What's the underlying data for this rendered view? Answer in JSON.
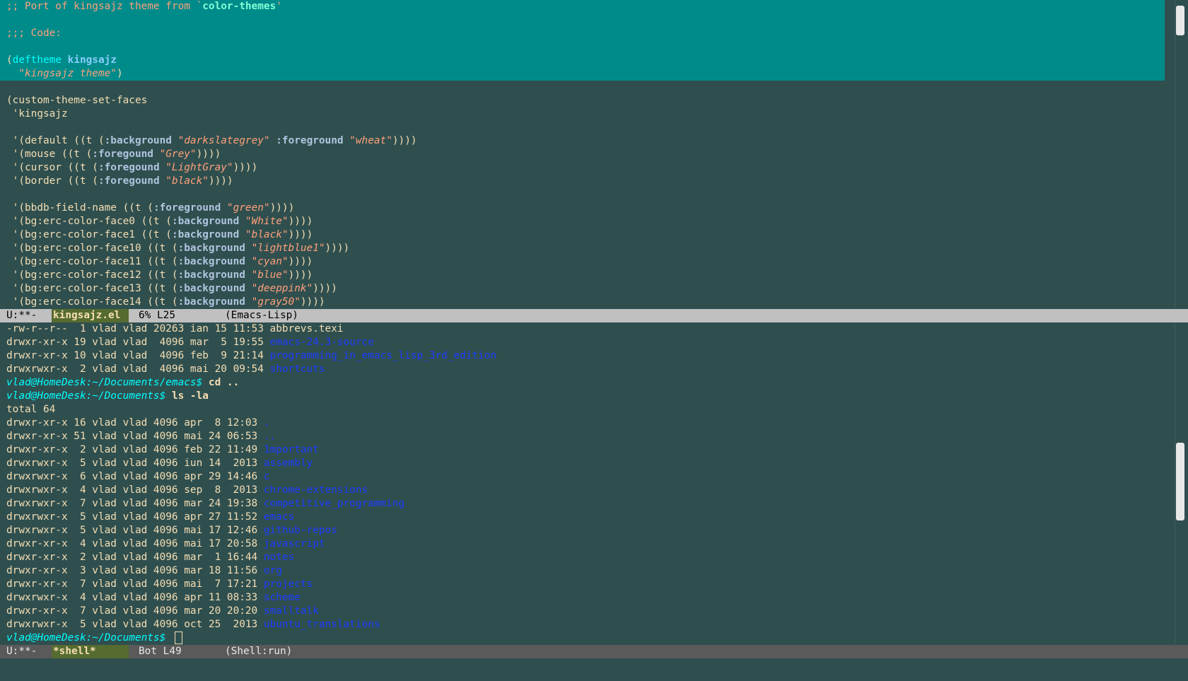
{
  "colors": {
    "background": "#2f4f4f",
    "foreground": "#f5deb3",
    "region": "#008b8b",
    "modeline_active": "#c0c0c0",
    "modeline_inactive": "#5a5a5a",
    "buffer_name_bg": "#556b2f",
    "directory": "#1e3cff",
    "prompt": "#00ffff",
    "string": "#ffa07a"
  },
  "top_buffer": {
    "lines": [
      {
        "region": true,
        "parts": [
          {
            "t": "comment",
            "v": ";; Port of kingsajz theme from `"
          },
          {
            "t": "const",
            "v": "color-themes"
          },
          {
            "t": "comment",
            "v": "'"
          }
        ]
      },
      {
        "region": true,
        "parts": []
      },
      {
        "region": true,
        "parts": [
          {
            "t": "comment",
            "v": ";;; Code:"
          }
        ]
      },
      {
        "region": true,
        "parts": []
      },
      {
        "region": true,
        "parts": [
          {
            "t": "plain",
            "v": "("
          },
          {
            "t": "keyword",
            "v": "deftheme"
          },
          {
            "t": "plain",
            "v": " "
          },
          {
            "t": "func",
            "v": "kingsajz"
          }
        ]
      },
      {
        "region": true,
        "parts": [
          {
            "t": "plain",
            "v": "  "
          },
          {
            "t": "string",
            "v": "\"kingsajz theme\""
          },
          {
            "t": "plain",
            "v": ")"
          }
        ]
      },
      {
        "region": false,
        "parts": []
      },
      {
        "region": false,
        "parts": [
          {
            "t": "plain",
            "v": "(custom-theme-set-faces"
          }
        ]
      },
      {
        "region": false,
        "parts": [
          {
            "t": "plain",
            "v": " 'kingsajz"
          }
        ]
      },
      {
        "region": false,
        "parts": []
      },
      {
        "region": false,
        "parts": [
          {
            "t": "plain",
            "v": " '(default ((t ("
          },
          {
            "t": "builtin",
            "v": ":background"
          },
          {
            "t": "plain",
            "v": " "
          },
          {
            "t": "string",
            "v": "\"darkslategrey\""
          },
          {
            "t": "plain",
            "v": " "
          },
          {
            "t": "builtin",
            "v": ":foreground"
          },
          {
            "t": "plain",
            "v": " "
          },
          {
            "t": "string",
            "v": "\"wheat\""
          },
          {
            "t": "plain",
            "v": "))))"
          }
        ]
      },
      {
        "region": false,
        "parts": [
          {
            "t": "plain",
            "v": " '(mouse ((t ("
          },
          {
            "t": "builtin",
            "v": ":foregound"
          },
          {
            "t": "plain",
            "v": " "
          },
          {
            "t": "string",
            "v": "\"Grey\""
          },
          {
            "t": "plain",
            "v": "))))"
          }
        ]
      },
      {
        "region": false,
        "parts": [
          {
            "t": "plain",
            "v": " '(cursor ((t ("
          },
          {
            "t": "builtin",
            "v": ":foregound"
          },
          {
            "t": "plain",
            "v": " "
          },
          {
            "t": "string",
            "v": "\"LightGray\""
          },
          {
            "t": "plain",
            "v": "))))"
          }
        ]
      },
      {
        "region": false,
        "parts": [
          {
            "t": "plain",
            "v": " '(border ((t ("
          },
          {
            "t": "builtin",
            "v": ":foregound"
          },
          {
            "t": "plain",
            "v": " "
          },
          {
            "t": "string",
            "v": "\"black\""
          },
          {
            "t": "plain",
            "v": "))))"
          }
        ]
      },
      {
        "region": false,
        "parts": []
      },
      {
        "region": false,
        "parts": [
          {
            "t": "plain",
            "v": " '(bbdb-field-name ((t ("
          },
          {
            "t": "builtin",
            "v": ":foreground"
          },
          {
            "t": "plain",
            "v": " "
          },
          {
            "t": "string",
            "v": "\"green\""
          },
          {
            "t": "plain",
            "v": "))))"
          }
        ]
      },
      {
        "region": false,
        "parts": [
          {
            "t": "plain",
            "v": " '(bg:erc-color-face0 ((t ("
          },
          {
            "t": "builtin",
            "v": ":background"
          },
          {
            "t": "plain",
            "v": " "
          },
          {
            "t": "string",
            "v": "\"White\""
          },
          {
            "t": "plain",
            "v": "))))"
          }
        ]
      },
      {
        "region": false,
        "parts": [
          {
            "t": "plain",
            "v": " '(bg:erc-color-face1 ((t ("
          },
          {
            "t": "builtin",
            "v": ":background"
          },
          {
            "t": "plain",
            "v": " "
          },
          {
            "t": "string",
            "v": "\"black\""
          },
          {
            "t": "plain",
            "v": "))))"
          }
        ]
      },
      {
        "region": false,
        "parts": [
          {
            "t": "plain",
            "v": " '(bg:erc-color-face10 ((t ("
          },
          {
            "t": "builtin",
            "v": ":background"
          },
          {
            "t": "plain",
            "v": " "
          },
          {
            "t": "string",
            "v": "\"lightblue1\""
          },
          {
            "t": "plain",
            "v": "))))"
          }
        ]
      },
      {
        "region": false,
        "parts": [
          {
            "t": "plain",
            "v": " '(bg:erc-color-face11 ((t ("
          },
          {
            "t": "builtin",
            "v": ":background"
          },
          {
            "t": "plain",
            "v": " "
          },
          {
            "t": "string",
            "v": "\"cyan\""
          },
          {
            "t": "plain",
            "v": "))))"
          }
        ]
      },
      {
        "region": false,
        "parts": [
          {
            "t": "plain",
            "v": " '(bg:erc-color-face12 ((t ("
          },
          {
            "t": "builtin",
            "v": ":background"
          },
          {
            "t": "plain",
            "v": " "
          },
          {
            "t": "string",
            "v": "\"blue\""
          },
          {
            "t": "plain",
            "v": "))))"
          }
        ]
      },
      {
        "region": false,
        "parts": [
          {
            "t": "plain",
            "v": " '(bg:erc-color-face13 ((t ("
          },
          {
            "t": "builtin",
            "v": ":background"
          },
          {
            "t": "plain",
            "v": " "
          },
          {
            "t": "string",
            "v": "\"deeppink\""
          },
          {
            "t": "plain",
            "v": "))))"
          }
        ]
      },
      {
        "region": false,
        "parts": [
          {
            "t": "plain",
            "v": " '(bg:erc-color-face14 ((t ("
          },
          {
            "t": "builtin",
            "v": ":background"
          },
          {
            "t": "plain",
            "v": " "
          },
          {
            "t": "string",
            "v": "\"gray50\""
          },
          {
            "t": "plain",
            "v": "))))"
          }
        ]
      }
    ]
  },
  "top_modeline": {
    "status": "U:**-",
    "buffer": "kingsajz.el",
    "position": "6% L25",
    "mode": "(Emacs-Lisp)"
  },
  "shell_buffer": {
    "lines": [
      {
        "parts": [
          {
            "t": "plain",
            "v": "-rw-r--r--  1 vlad vlad 20263 ian 15 11:53 abbrevs.texi"
          }
        ]
      },
      {
        "parts": [
          {
            "t": "plain",
            "v": "drwxr-xr-x 19 vlad vlad  4096 mar  5 19:55 "
          },
          {
            "t": "dir",
            "v": "emacs-24.3-source"
          }
        ]
      },
      {
        "parts": [
          {
            "t": "plain",
            "v": "drwxr-xr-x 10 vlad vlad  4096 feb  9 21:14 "
          },
          {
            "t": "dir",
            "v": "programming_in_emacs_lisp_3rd_edition"
          }
        ]
      },
      {
        "parts": [
          {
            "t": "plain",
            "v": "drwxrwxr-x  2 vlad vlad  4096 mai 20 09:54 "
          },
          {
            "t": "dir",
            "v": "shortcuts"
          }
        ]
      },
      {
        "parts": [
          {
            "t": "prompt",
            "v": "vlad@HomeDesk:~/Documents/emacs$"
          },
          {
            "t": "plain",
            "v": " "
          },
          {
            "t": "cmd",
            "v": "cd .."
          }
        ]
      },
      {
        "parts": [
          {
            "t": "prompt",
            "v": "vlad@HomeDesk:~/Documents$"
          },
          {
            "t": "plain",
            "v": " "
          },
          {
            "t": "cmd",
            "v": "ls -la"
          }
        ]
      },
      {
        "parts": [
          {
            "t": "plain",
            "v": "total 64"
          }
        ]
      },
      {
        "parts": [
          {
            "t": "plain",
            "v": "drwxr-xr-x 16 vlad vlad 4096 apr  8 12:03 "
          },
          {
            "t": "dir",
            "v": "."
          }
        ]
      },
      {
        "parts": [
          {
            "t": "plain",
            "v": "drwxr-xr-x 51 vlad vlad 4096 mai 24 06:53 "
          },
          {
            "t": "dir",
            "v": ".."
          }
        ]
      },
      {
        "parts": [
          {
            "t": "plain",
            "v": "drwxr-xr-x  2 vlad vlad 4096 feb 22 11:49 "
          },
          {
            "t": "dir",
            "v": "1mportant"
          }
        ]
      },
      {
        "parts": [
          {
            "t": "plain",
            "v": "drwxrwxr-x  5 vlad vlad 4096 iun 14  2013 "
          },
          {
            "t": "dir",
            "v": "assembly"
          }
        ]
      },
      {
        "parts": [
          {
            "t": "plain",
            "v": "drwxrwxr-x  6 vlad vlad 4096 apr 29 14:46 "
          },
          {
            "t": "dir",
            "v": "c"
          }
        ]
      },
      {
        "parts": [
          {
            "t": "plain",
            "v": "drwxrwxr-x  4 vlad vlad 4096 sep  8  2013 "
          },
          {
            "t": "dir",
            "v": "chrome-extensions"
          }
        ]
      },
      {
        "parts": [
          {
            "t": "plain",
            "v": "drwxrwxr-x  7 vlad vlad 4096 mar 24 19:38 "
          },
          {
            "t": "dir",
            "v": "competitive_programming"
          }
        ]
      },
      {
        "parts": [
          {
            "t": "plain",
            "v": "drwxrwxr-x  5 vlad vlad 4096 apr 27 11:52 "
          },
          {
            "t": "dir",
            "v": "emacs"
          }
        ]
      },
      {
        "parts": [
          {
            "t": "plain",
            "v": "drwxrwxr-x  5 vlad vlad 4096 mai 17 12:46 "
          },
          {
            "t": "dir",
            "v": "github-repos"
          }
        ]
      },
      {
        "parts": [
          {
            "t": "plain",
            "v": "drwxr-xr-x  4 vlad vlad 4096 mai 17 20:58 "
          },
          {
            "t": "dir",
            "v": "javascript"
          }
        ]
      },
      {
        "parts": [
          {
            "t": "plain",
            "v": "drwxr-xr-x  2 vlad vlad 4096 mar  1 16:44 "
          },
          {
            "t": "dir",
            "v": "notes"
          }
        ]
      },
      {
        "parts": [
          {
            "t": "plain",
            "v": "drwxr-xr-x  3 vlad vlad 4096 mar 18 11:56 "
          },
          {
            "t": "dir",
            "v": "org"
          }
        ]
      },
      {
        "parts": [
          {
            "t": "plain",
            "v": "drwxr-xr-x  7 vlad vlad 4096 mai  7 17:21 "
          },
          {
            "t": "dir",
            "v": "projects"
          }
        ]
      },
      {
        "parts": [
          {
            "t": "plain",
            "v": "drwxrwxr-x  4 vlad vlad 4096 apr 11 08:33 "
          },
          {
            "t": "dir",
            "v": "scheme"
          }
        ]
      },
      {
        "parts": [
          {
            "t": "plain",
            "v": "drwxr-xr-x  7 vlad vlad 4096 mar 20 20:20 "
          },
          {
            "t": "dir",
            "v": "smalltalk"
          }
        ]
      },
      {
        "parts": [
          {
            "t": "plain",
            "v": "drwxrwxr-x  5 vlad vlad 4096 oct 25  2013 "
          },
          {
            "t": "dir",
            "v": "ubuntu_translations"
          }
        ]
      },
      {
        "parts": [
          {
            "t": "prompt",
            "v": "vlad@HomeDesk:~/Documents$"
          },
          {
            "t": "plain",
            "v": " "
          }
        ],
        "cursor": true
      }
    ]
  },
  "bottom_modeline": {
    "status": "U:**-",
    "buffer": "*shell*",
    "position": "Bot L49",
    "mode": "(Shell:run)"
  }
}
